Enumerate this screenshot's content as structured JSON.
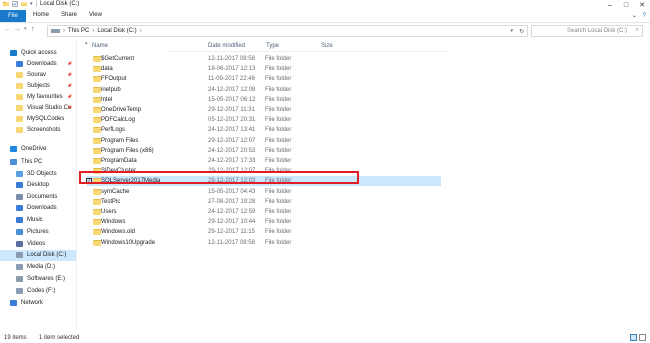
{
  "window": {
    "title": "Local Disk (C:)"
  },
  "ribbon": {
    "tabs": [
      "File",
      "Home",
      "Share",
      "View"
    ]
  },
  "address": {
    "crumbs": [
      "This PC",
      "Local Disk (C:)"
    ],
    "search_placeholder": "Search Local Disk (C:)"
  },
  "nav": {
    "items": [
      {
        "label": "Quick access",
        "icon": "star-icon",
        "color": "#1979ca"
      },
      {
        "label": "Downloads",
        "icon": "download-icon",
        "color": "#3a7bd5",
        "pinned": true
      },
      {
        "label": "Sourav",
        "icon": "folder-icon",
        "color": "#f8d775",
        "pinned": true
      },
      {
        "label": "Subjects",
        "icon": "folder-icon",
        "color": "#f8d775",
        "pinned": true
      },
      {
        "label": "My favourites",
        "icon": "folder-icon",
        "color": "#f8d775",
        "pinned": true
      },
      {
        "label": "Visual Studio Co",
        "icon": "folder-icon",
        "color": "#f8d775",
        "pinned": true
      },
      {
        "label": "MySQLCodes",
        "icon": "folder-icon",
        "color": "#f8d775"
      },
      {
        "label": "Screenshots",
        "icon": "folder-icon",
        "color": "#f8d775"
      },
      {
        "label": "OneDrive",
        "icon": "cloud-icon",
        "color": "#1e88e5"
      },
      {
        "label": "This PC",
        "icon": "computer-icon",
        "color": "#4a90d9"
      },
      {
        "label": "3D Objects",
        "icon": "cube-icon",
        "color": "#5aa0e6"
      },
      {
        "label": "Desktop",
        "icon": "desktop-icon",
        "color": "#3a7bd5"
      },
      {
        "label": "Documents",
        "icon": "document-icon",
        "color": "#7a8ea8"
      },
      {
        "label": "Downloads",
        "icon": "download-icon",
        "color": "#3a7bd5"
      },
      {
        "label": "Music",
        "icon": "music-icon",
        "color": "#3a7bd5"
      },
      {
        "label": "Pictures",
        "icon": "picture-icon",
        "color": "#4a90d9"
      },
      {
        "label": "Videos",
        "icon": "video-icon",
        "color": "#5a6fa0"
      },
      {
        "label": "Local Disk (C:)",
        "icon": "drive-icon",
        "color": "#8a9bb0",
        "selected": true
      },
      {
        "label": "Media (D:)",
        "icon": "drive-icon",
        "color": "#8a9bb0"
      },
      {
        "label": "Softwares (E:)",
        "icon": "drive-icon",
        "color": "#8a9bb0"
      },
      {
        "label": "Codes (F:)",
        "icon": "drive-icon",
        "color": "#8a9bb0"
      },
      {
        "label": "Network",
        "icon": "network-icon",
        "color": "#3a7bd5"
      }
    ]
  },
  "columns": {
    "name": "Name",
    "date": "Date modified",
    "type": "Type",
    "size": "Size"
  },
  "files": [
    {
      "name": "$GetCurrent",
      "date": "12-11-2017 08:58",
      "type": "File folder"
    },
    {
      "name": "data",
      "date": "18-06-2017 12:13",
      "type": "File folder"
    },
    {
      "name": "FFOutput",
      "date": "11-09-2017 22:46",
      "type": "File folder"
    },
    {
      "name": "inetpub",
      "date": "24-12-2017 12:08",
      "type": "File folder"
    },
    {
      "name": "Intel",
      "date": "15-05-2017 06:12",
      "type": "File folder"
    },
    {
      "name": "OneDriveTemp",
      "date": "29-12-2017 11:31",
      "type": "File folder"
    },
    {
      "name": "PDFCalcLog",
      "date": "05-12-2017 20:31",
      "type": "File folder"
    },
    {
      "name": "PerfLogs",
      "date": "24-12-2017 13:41",
      "type": "File folder"
    },
    {
      "name": "Program Files",
      "date": "29-12-2017 12:07",
      "type": "File folder"
    },
    {
      "name": "Program Files (x86)",
      "date": "24-12-2017 20:53",
      "type": "File folder"
    },
    {
      "name": "ProgramData",
      "date": "24-12-2017 17:33",
      "type": "File folder"
    },
    {
      "name": "SlDevCluster",
      "date": "29-12-2017 12:07",
      "type": "File folder"
    },
    {
      "name": "SQLServer2017Media",
      "date": "29-12-2017 12:03",
      "type": "File folder",
      "selected": true
    },
    {
      "name": "symCache",
      "date": "15-05-2017 04:43",
      "type": "File folder"
    },
    {
      "name": "TestPic",
      "date": "27-08-2017 19:28",
      "type": "File folder"
    },
    {
      "name": "Users",
      "date": "24-12-2017 12:59",
      "type": "File folder"
    },
    {
      "name": "Windows",
      "date": "29-12-2017 10:44",
      "type": "File folder"
    },
    {
      "name": "Windows.old",
      "date": "29-12-2017 11:15",
      "type": "File folder"
    },
    {
      "name": "Windows10Upgrade",
      "date": "12-11-2017 08:58",
      "type": "File folder"
    }
  ],
  "status": {
    "items": "19 items",
    "selected": "1 item selected"
  },
  "colors": {
    "accent": "#1979ca",
    "selection": "#cce8ff",
    "highlight_box": "#e11d28"
  }
}
